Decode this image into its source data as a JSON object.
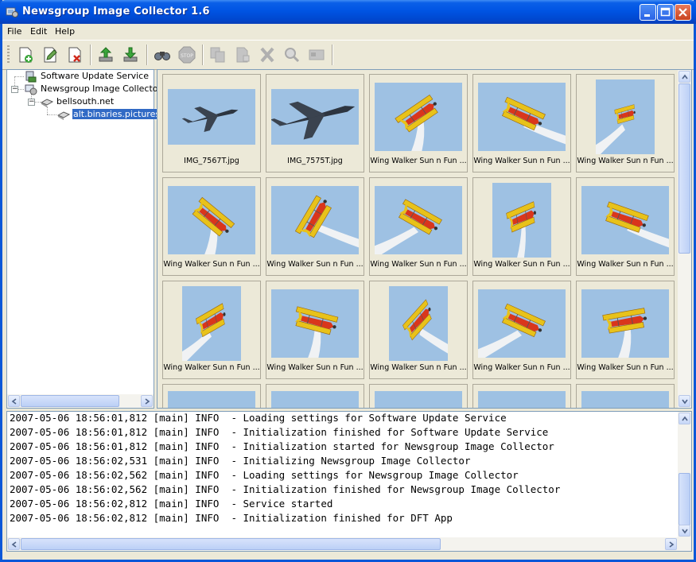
{
  "window": {
    "title": "Newsgroup Image Collector 1.6",
    "title_bar_color": "#0054e3"
  },
  "title_buttons": [
    "minimize",
    "maximize",
    "close"
  ],
  "menu": {
    "items": [
      "File",
      "Edit",
      "Help"
    ]
  },
  "toolbar": {
    "icons": [
      "new-icon",
      "edit-icon",
      "delete-icon",
      "upload-icon",
      "download-icon",
      "binoculars-icon",
      "stop-icon",
      "copy-icon",
      "paste-icon",
      "cut-icon",
      "magnify-icon",
      "card-icon"
    ]
  },
  "tree": {
    "nodes": [
      {
        "label": "Software Update Service",
        "selected": false
      },
      {
        "label": "Newsgroup Image Collector",
        "selected": false,
        "expanded": true
      },
      {
        "label": "bellsouth.net",
        "selected": false,
        "expanded": true
      },
      {
        "label": "alt.binaries.pictures.a",
        "selected": true
      }
    ]
  },
  "thumbnails": [
    {
      "caption": "IMG_7567T.jpg",
      "subject": "jet"
    },
    {
      "caption": "IMG_7575T.jpg",
      "subject": "jet-close"
    },
    {
      "caption": "Wing Walker Sun n Fun ...",
      "subject": "biplane"
    },
    {
      "caption": "Wing Walker Sun n Fun ...",
      "subject": "biplane"
    },
    {
      "caption": "Wing Walker Sun n Fun ...",
      "subject": "biplane-small"
    },
    {
      "caption": "Wing Walker Sun n Fun ...",
      "subject": "biplane"
    },
    {
      "caption": "Wing Walker Sun n Fun ...",
      "subject": "biplane"
    },
    {
      "caption": "Wing Walker Sun n Fun ...",
      "subject": "biplane"
    },
    {
      "caption": "Wing Walker Sun n Fun ...",
      "subject": "biplane-vertical"
    },
    {
      "caption": "Wing Walker Sun n Fun ...",
      "subject": "biplane"
    },
    {
      "caption": "Wing Walker Sun n Fun ...",
      "subject": "biplane"
    },
    {
      "caption": "Wing Walker Sun n Fun ...",
      "subject": "biplane"
    },
    {
      "caption": "Wing Walker Sun n Fun ...",
      "subject": "biplane"
    },
    {
      "caption": "Wing Walker Sun n Fun ...",
      "subject": "biplane"
    },
    {
      "caption": "Wing Walker Sun n Fun ...",
      "subject": "biplane"
    },
    {
      "caption": "",
      "subject": "partial"
    },
    {
      "caption": "",
      "subject": "partial"
    },
    {
      "caption": "",
      "subject": "partial"
    },
    {
      "caption": "",
      "subject": "partial"
    },
    {
      "caption": "",
      "subject": "partial"
    }
  ],
  "log": {
    "lines": [
      "2007-05-06 18:56:01,812 [main] INFO  - Loading settings for Software Update Service",
      "2007-05-06 18:56:01,812 [main] INFO  - Initialization finished for Software Update Service",
      "2007-05-06 18:56:01,812 [main] INFO  - Initialization started for Newsgroup Image Collector",
      "2007-05-06 18:56:02,531 [main] INFO  - Initializing Newsgroup Image Collector",
      "2007-05-06 18:56:02,562 [main] INFO  - Loading settings for Newsgroup Image Collector",
      "2007-05-06 18:56:02,562 [main] INFO  - Initialization finished for Newsgroup Image Collector",
      "2007-05-06 18:56:02,812 [main] INFO  - Service started",
      "2007-05-06 18:56:02,812 [main] INFO  - Initialization finished for DFT App"
    ]
  },
  "colors": {
    "sky": "#9ec1e3",
    "selection": "#316ac5",
    "plane_yellow": "#e8c21a",
    "plane_red": "#d9361c"
  }
}
